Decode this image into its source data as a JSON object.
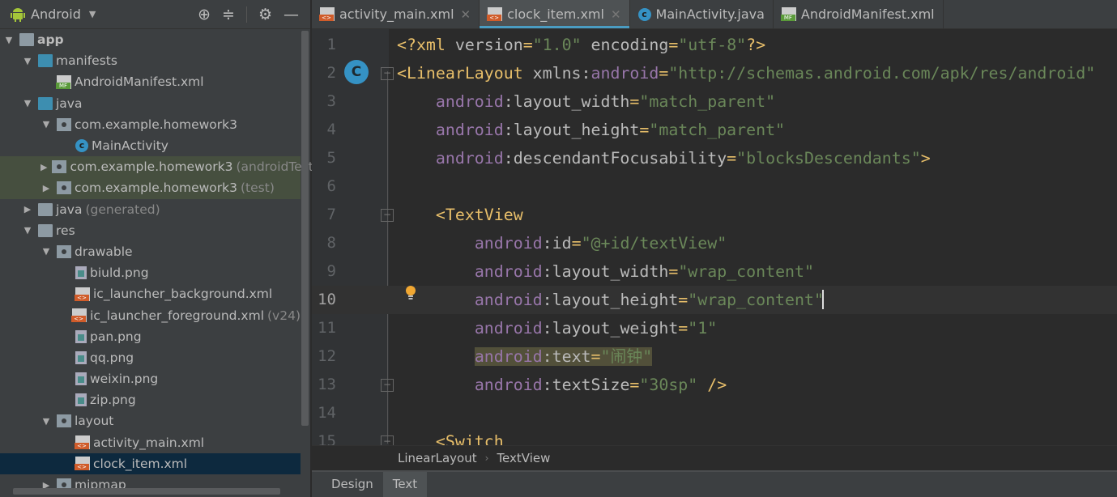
{
  "sidebar": {
    "view_selector": "Android",
    "tree": [
      {
        "label": "app",
        "depth": 0,
        "arrow": "down",
        "icon": "module-folder",
        "bold": true
      },
      {
        "label": "manifests",
        "depth": 1,
        "arrow": "down",
        "icon": "folder"
      },
      {
        "label": "AndroidManifest.xml",
        "depth": 2,
        "icon": "manifest-file"
      },
      {
        "label": "java",
        "depth": 1,
        "arrow": "down",
        "icon": "folder"
      },
      {
        "label": "com.example.homework3",
        "depth": 2,
        "arrow": "down",
        "icon": "package"
      },
      {
        "label": "MainActivity",
        "depth": 3,
        "icon": "class"
      },
      {
        "label": "com.example.homework3",
        "suffix": "(androidTest)",
        "depth": 2,
        "arrow": "right",
        "icon": "package",
        "highlight": true
      },
      {
        "label": "com.example.homework3",
        "suffix": "(test)",
        "depth": 2,
        "arrow": "right",
        "icon": "package",
        "highlight": true
      },
      {
        "label": "java",
        "suffix": "(generated)",
        "depth": 1,
        "arrow": "right",
        "icon": "generated-folder"
      },
      {
        "label": "res",
        "depth": 1,
        "arrow": "down",
        "icon": "res-folder"
      },
      {
        "label": "drawable",
        "depth": 2,
        "arrow": "down",
        "icon": "package"
      },
      {
        "label": "biuld.png",
        "depth": 3,
        "icon": "image-file"
      },
      {
        "label": "ic_launcher_background.xml",
        "depth": 3,
        "icon": "xml-file"
      },
      {
        "label": "ic_launcher_foreground.xml",
        "suffix": "(v24)",
        "depth": 3,
        "icon": "xml-file"
      },
      {
        "label": "pan.png",
        "depth": 3,
        "icon": "image-file"
      },
      {
        "label": "qq.png",
        "depth": 3,
        "icon": "image-file"
      },
      {
        "label": "weixin.png",
        "depth": 3,
        "icon": "image-file"
      },
      {
        "label": "zip.png",
        "depth": 3,
        "icon": "image-file"
      },
      {
        "label": "layout",
        "depth": 2,
        "arrow": "down",
        "icon": "package"
      },
      {
        "label": "activity_main.xml",
        "depth": 3,
        "icon": "xml-file"
      },
      {
        "label": "clock_item.xml",
        "depth": 3,
        "icon": "xml-file",
        "selected": true
      },
      {
        "label": "mipmap",
        "depth": 2,
        "arrow": "right",
        "icon": "package"
      }
    ]
  },
  "tabs": [
    {
      "label": "activity_main.xml",
      "icon": "xml-file",
      "closable": true
    },
    {
      "label": "clock_item.xml",
      "icon": "xml-file",
      "closable": true,
      "active": true
    },
    {
      "label": "MainActivity.java",
      "icon": "class"
    },
    {
      "label": "AndroidManifest.xml",
      "icon": "manifest-file"
    }
  ],
  "editor": {
    "current_line": 10,
    "lines": [
      {
        "n": "1",
        "tokens": [
          [
            "tag",
            "<?xml "
          ],
          [
            "attr",
            "version"
          ],
          [
            "tag",
            "="
          ],
          [
            "val",
            "\"1.0\""
          ],
          [
            "attr",
            " encoding"
          ],
          [
            "tag",
            "="
          ],
          [
            "val",
            "\"utf-8\""
          ],
          [
            "tag",
            "?>"
          ]
        ]
      },
      {
        "n": "2",
        "fold": true,
        "tokens": [
          [
            "tag",
            "<LinearLayout "
          ],
          [
            "attr",
            "xmlns:"
          ],
          [
            "ns",
            "android"
          ],
          [
            "tag",
            "="
          ],
          [
            "val",
            "\"http://schemas.android.com/apk/res/android\""
          ]
        ]
      },
      {
        "n": "3",
        "tokens": [
          [
            "plain",
            "    "
          ],
          [
            "ns",
            "android"
          ],
          [
            "attr",
            ":layout_width"
          ],
          [
            "tag",
            "="
          ],
          [
            "val",
            "\"match_parent\""
          ]
        ]
      },
      {
        "n": "4",
        "tokens": [
          [
            "plain",
            "    "
          ],
          [
            "ns",
            "android"
          ],
          [
            "attr",
            ":layout_height"
          ],
          [
            "tag",
            "="
          ],
          [
            "val",
            "\"match_parent\""
          ]
        ]
      },
      {
        "n": "5",
        "tokens": [
          [
            "plain",
            "    "
          ],
          [
            "ns",
            "android"
          ],
          [
            "attr",
            ":descendantFocusability"
          ],
          [
            "tag",
            "="
          ],
          [
            "val",
            "\"blocksDescendants\""
          ],
          [
            "tag",
            ">"
          ]
        ]
      },
      {
        "n": "6",
        "tokens": []
      },
      {
        "n": "7",
        "fold": true,
        "tokens": [
          [
            "plain",
            "    "
          ],
          [
            "tag",
            "<TextView"
          ]
        ]
      },
      {
        "n": "8",
        "tokens": [
          [
            "plain",
            "        "
          ],
          [
            "ns",
            "android"
          ],
          [
            "attr",
            ":id"
          ],
          [
            "tag",
            "="
          ],
          [
            "val",
            "\"@+id/textView\""
          ]
        ]
      },
      {
        "n": "9",
        "tokens": [
          [
            "plain",
            "        "
          ],
          [
            "ns",
            "android"
          ],
          [
            "attr",
            ":layout_width"
          ],
          [
            "tag",
            "="
          ],
          [
            "val",
            "\"wrap_content\""
          ]
        ]
      },
      {
        "n": "10",
        "tokens": [
          [
            "plain",
            "        "
          ],
          [
            "ns",
            "android"
          ],
          [
            "attr",
            ":layout_height"
          ],
          [
            "tag",
            "="
          ],
          [
            "val",
            "\"wrap_content\""
          ]
        ]
      },
      {
        "n": "11",
        "tokens": [
          [
            "plain",
            "        "
          ],
          [
            "ns",
            "android"
          ],
          [
            "attr",
            ":layout_weight"
          ],
          [
            "tag",
            "="
          ],
          [
            "val",
            "\"1\""
          ]
        ]
      },
      {
        "n": "12",
        "highlight": true,
        "tokens": [
          [
            "plain",
            "        "
          ],
          [
            "ns",
            "android"
          ],
          [
            "attr",
            ":text"
          ],
          [
            "tag",
            "="
          ],
          [
            "val",
            "\"闹钟\""
          ]
        ]
      },
      {
        "n": "13",
        "fold": true,
        "tokens": [
          [
            "plain",
            "        "
          ],
          [
            "ns",
            "android"
          ],
          [
            "attr",
            ":textSize"
          ],
          [
            "tag",
            "="
          ],
          [
            "val",
            "\"30sp\""
          ],
          [
            "tag",
            " />"
          ]
        ]
      },
      {
        "n": "14",
        "tokens": []
      },
      {
        "n": "15",
        "fold": true,
        "tokens": [
          [
            "plain",
            "    "
          ],
          [
            "tag",
            "<Switch"
          ]
        ]
      }
    ]
  },
  "breadcrumb": [
    "LinearLayout",
    "TextView"
  ],
  "bottom_tabs": [
    {
      "label": "Design"
    },
    {
      "label": "Text",
      "active": true
    }
  ],
  "colors": {
    "tag": "#e8bf6a",
    "namespace": "#9876aa",
    "attribute": "#bababa",
    "value": "#6a8759",
    "accent": "#4a9cc2"
  }
}
